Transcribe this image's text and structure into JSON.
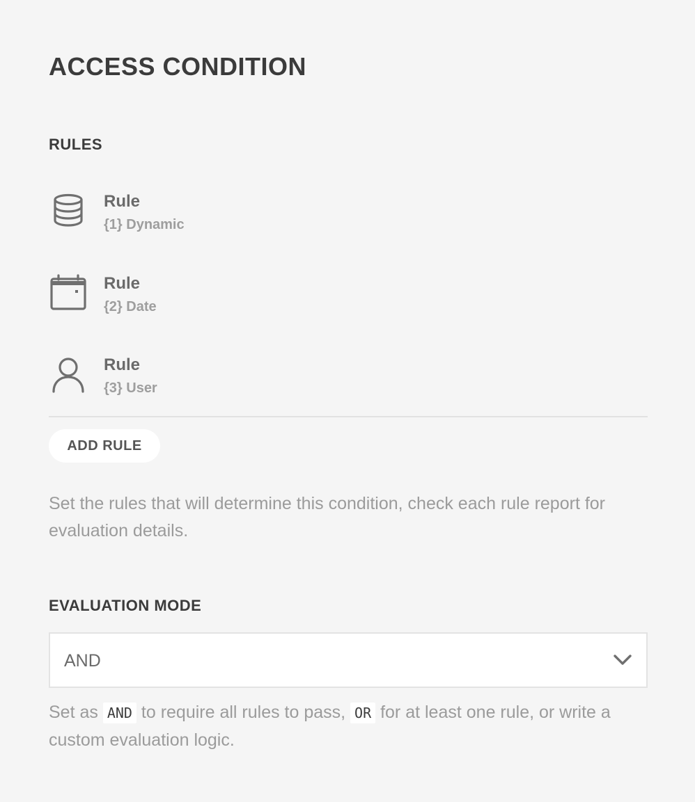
{
  "page": {
    "title": "ACCESS CONDITION"
  },
  "rules": {
    "section_title": "RULES",
    "items": [
      {
        "icon": "database-icon",
        "name": "Rule",
        "detail": "{1} Dynamic"
      },
      {
        "icon": "calendar-icon",
        "name": "Rule",
        "detail": "{2} Date"
      },
      {
        "icon": "user-icon",
        "name": "Rule",
        "detail": "{3} User"
      }
    ],
    "add_button_label": "ADD RULE",
    "help_text": "Set the rules that will determine this condition, check each rule report for evaluation details."
  },
  "evaluation": {
    "section_title": "EVALUATION MODE",
    "selected_value": "AND",
    "help": {
      "part1": "Set as ",
      "code1": "AND",
      "part2": " to require all rules to pass, ",
      "code2": "OR",
      "part3": " for at least one rule, or write a custom evaluation logic."
    }
  },
  "colors": {
    "background": "#f5f5f5",
    "title": "#3b3b3b",
    "muted_text": "#9b9b9b",
    "icon": "#6f6f6f",
    "surface": "#ffffff",
    "border": "#e3e3e3"
  }
}
